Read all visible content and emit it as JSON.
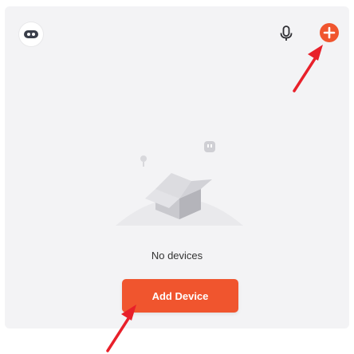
{
  "header": {
    "avatar_icon": "robot-avatar-icon",
    "mic_icon": "microphone-icon",
    "add_icon": "plus-circle-icon"
  },
  "empty_state": {
    "message": "No devices",
    "illustration_icon": "empty-box-icon"
  },
  "actions": {
    "add_device_label": "Add Device"
  },
  "colors": {
    "accent": "#f0552e",
    "panel_bg": "#f3f3f5",
    "annotation_arrow": "#e8202a"
  }
}
